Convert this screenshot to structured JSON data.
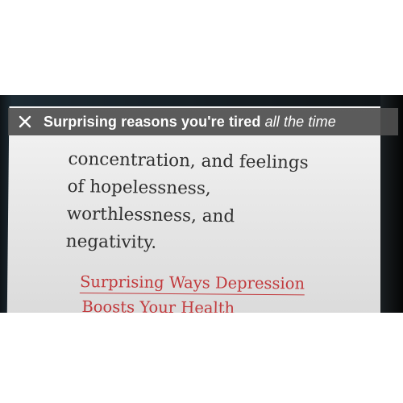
{
  "modal": {
    "title_prefix": "Surprising reasons you're tired ",
    "title_emphasis": "all the time"
  },
  "article": {
    "lines": [
      "concentration, and feelings",
      "of hopelessness,",
      "worthlessness, and",
      "negativity."
    ],
    "related_link": {
      "line1": "Surprising Ways Depression",
      "line2": "Boosts Your Health"
    }
  },
  "icons": {
    "close": "close-icon"
  },
  "colors": {
    "title_bar": "#4e4e4e",
    "link": "#c23a3d",
    "body_text": "#2f2f2f"
  }
}
